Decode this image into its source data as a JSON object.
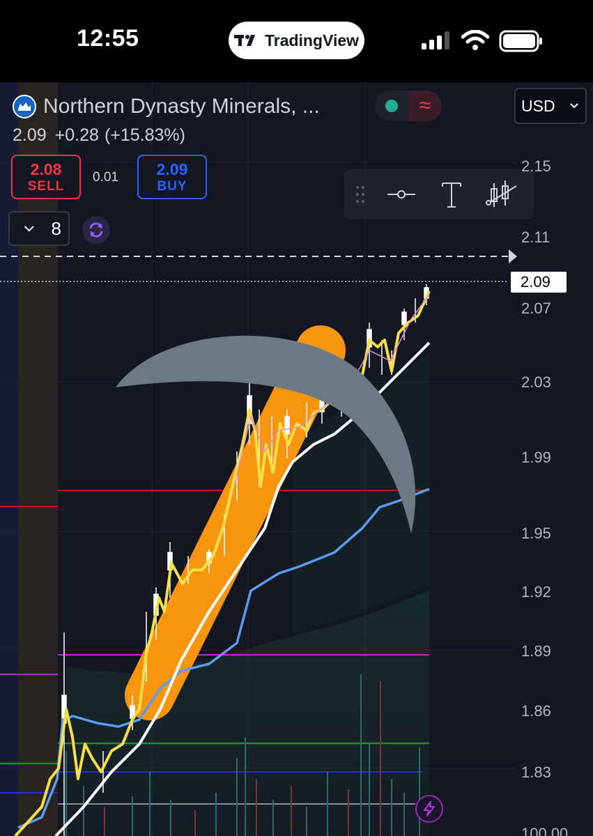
{
  "status_bar": {
    "time": "12:55",
    "app_pill": "TradingView"
  },
  "symbol": {
    "name": "Northern Dynasty Minerals, ...",
    "currency": "USD",
    "last_price": "2.09",
    "change": "+0.28",
    "change_pct": "(+15.83%)"
  },
  "trade": {
    "sell_price": "2.08",
    "sell_label": "SELL",
    "spread": "0.01",
    "buy_price": "2.09",
    "buy_label": "BUY"
  },
  "interval": {
    "value": "8"
  },
  "price_axis": {
    "labels": [
      "2.15",
      "2.11",
      "2.07",
      "2.03",
      "1.99",
      "1.95",
      "1.92",
      "1.89",
      "1.86",
      "1.83",
      "100.00"
    ],
    "current_price_tag": "2.09"
  },
  "colors": {
    "background": "#131722",
    "sell": "#f23645",
    "buy": "#2962ff",
    "price_line_yellow": "#f5e04a",
    "vwap_white": "#ffffff",
    "ma_blue": "#5b9cf0",
    "pickaxe_handle": "#f7960e",
    "pickaxe_head": "#6b7a85"
  },
  "icons": {
    "toolbar": [
      "drag-handle-icon",
      "horizontal-line-icon",
      "text-icon",
      "candles-icon"
    ],
    "refresh": "refresh-icon",
    "alert": "lightning-icon"
  }
}
